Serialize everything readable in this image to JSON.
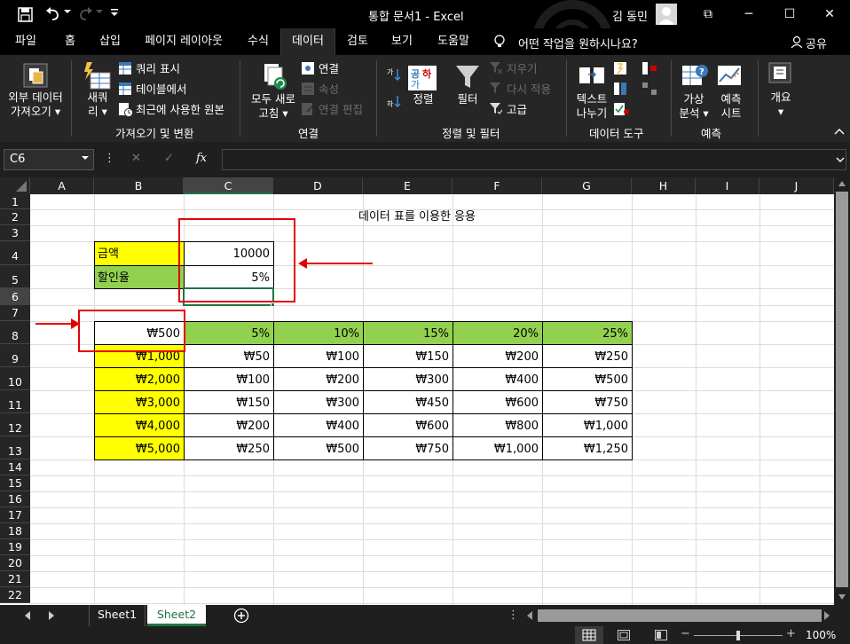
{
  "window": {
    "title": "통합 문서1  -  Excel",
    "user_name": "김 동민",
    "restore_label": "⧉",
    "minimize_label": "─",
    "maximize_label": "☐",
    "close_label": "✕"
  },
  "menu": {
    "tabs": [
      "파일",
      "홈",
      "삽입",
      "페이지 레이아웃",
      "수식",
      "데이터",
      "검토",
      "보기",
      "도움말"
    ],
    "tell_me": "어떤 작업을 원하시나요?",
    "share": "공유",
    "active_tab": "데이터"
  },
  "ribbon": {
    "get_external": "외부 데이터",
    "get_external2": "가져오기",
    "new_query": "새쿼",
    "new_query2": "리",
    "show_queries": "쿼리 표시",
    "from_table": "테이블에서",
    "recent_sources": "최근에 사용한 원본",
    "group_get_transform": "가져오기 및 변환",
    "refresh_all": "모두 새로",
    "refresh_all2": "고침",
    "connections": "연결",
    "properties": "속성",
    "edit_links": "연결 편집",
    "group_connections": "연결",
    "sort": "정렬",
    "sort_az_icon_text": "공!",
    "filter": "필터",
    "clear": "지우기",
    "reapply": "다시 적용",
    "advanced": "고급",
    "group_sort_filter": "정렬 및 필터",
    "text_to_columns": "텍스트",
    "text_to_columns2": "나누기",
    "group_data_tools": "데이터 도구",
    "what_if": "가상",
    "what_if2": "분석",
    "forecast_sheet": "예측",
    "forecast_sheet2": "시트",
    "group_forecast": "예측",
    "outline": "개요"
  },
  "formula_bar": {
    "name_box": "C6",
    "cancel": "✕",
    "enter": "✓",
    "fx": "fx",
    "content": ""
  },
  "sheet": {
    "columns": [
      "A",
      "B",
      "C",
      "D",
      "E",
      "F",
      "G",
      "H",
      "I",
      "J"
    ],
    "rows": [
      "1",
      "2",
      "3",
      "4",
      "5",
      "6",
      "7",
      "8",
      "9",
      "10",
      "11",
      "12",
      "13",
      "14",
      "15",
      "16",
      "17",
      "18",
      "19",
      "20",
      "21",
      "22"
    ],
    "title": "데이터 표를 이용한 응용",
    "amount_label": "금액",
    "amount_value": "10000",
    "discount_label": "할인율",
    "discount_value": "5%",
    "table_corner": "₩500",
    "rate_headers": [
      "5%",
      "10%",
      "15%",
      "20%",
      "25%"
    ],
    "amounts": [
      "₩1,000",
      "₩2,000",
      "₩3,000",
      "₩4,000",
      "₩5,000"
    ],
    "results": [
      [
        "₩50",
        "₩100",
        "₩150",
        "₩200",
        "₩250"
      ],
      [
        "₩100",
        "₩200",
        "₩300",
        "₩400",
        "₩500"
      ],
      [
        "₩150",
        "₩300",
        "₩450",
        "₩600",
        "₩750"
      ],
      [
        "₩200",
        "₩400",
        "₩600",
        "₩800",
        "₩1,000"
      ],
      [
        "₩250",
        "₩500",
        "₩750",
        "₩1,000",
        "₩1,250"
      ]
    ],
    "colors": {
      "yellow": "#ffff00",
      "green": "#92d050",
      "red": "#e30000"
    }
  },
  "sheet_tabs": [
    "Sheet1",
    "Sheet2"
  ],
  "active_sheet": "Sheet2",
  "status": {
    "zoom": "100%",
    "zoom_minus": "−",
    "zoom_plus": "+"
  }
}
